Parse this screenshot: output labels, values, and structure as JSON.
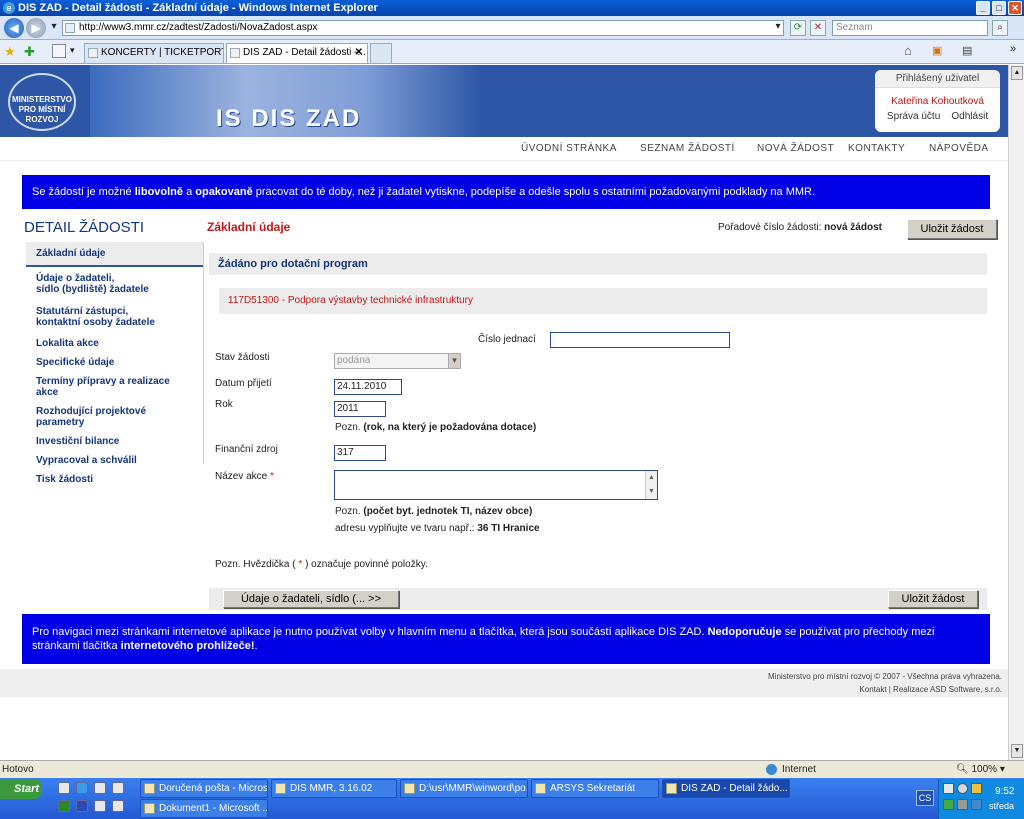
{
  "window": {
    "title": "DIS ZAD - Detail žádosti - Základní údaje - Windows Internet Explorer"
  },
  "browser": {
    "url": "http://www3.mmr.cz/zadtest/Zadosti/NovaZadost.aspx",
    "search_placeholder": "Seznam",
    "tabs": [
      "KONCERTY | TICKETPORTAL...",
      "DIS ZAD - Detail žádosti -..."
    ]
  },
  "header": {
    "logo_text": "MINISTERSTVO PRO MÍSTNÍ ROZVOJ",
    "brand": "IS DIS ZAD",
    "user_box_title": "Přihlášený uživatel",
    "user_name": "Kateřina Kohoutková",
    "account_link": "Správa účtu",
    "logout_link": "Odhlásit"
  },
  "nav": {
    "items": [
      "ÚVODNÍ STRÁNKA",
      "SEZNAM ŽÁDOSTÍ",
      "NOVÁ ŽÁDOST",
      "KONTAKTY",
      "NÁPOVĚDA"
    ]
  },
  "info_top": {
    "p1": "Se žádostí je možné ",
    "b1": "libovolně",
    "p2": " a ",
    "b2": "opakovaně",
    "p3": " pracovat do té doby, než ji žadatel vytiskne, podepíše a odešle spolu s ostatními požadovanými podklady na MMR."
  },
  "sidebar": {
    "title": "DETAIL ŽÁDOSTI",
    "items": [
      {
        "l1": "Základní údaje",
        "l2": ""
      },
      {
        "l1": "Údaje o žadateli,",
        "l2": "sídlo (bydliště) žadatele"
      },
      {
        "l1": "Statutární zástupci,",
        "l2": "kontaktní osoby žadatele"
      },
      {
        "l1": "Lokalita akce",
        "l2": ""
      },
      {
        "l1": "Specifické údaje",
        "l2": ""
      },
      {
        "l1": "Termíny přípravy a realizace akce",
        "l2": ""
      },
      {
        "l1": "Rozhodující projektové parametry",
        "l2": ""
      },
      {
        "l1": "Investiční bilance",
        "l2": ""
      },
      {
        "l1": "Vypracoval a schválil",
        "l2": ""
      },
      {
        "l1": "Tisk žádosti",
        "l2": ""
      }
    ]
  },
  "main": {
    "section_title": "Základní údaje",
    "order_label": "Pořadové číslo žádosti:",
    "order_value": "nová žádost",
    "save_button": "Uložit žádost",
    "program_heading": "Žádáno pro dotační program",
    "program_value": "117D51300 - Podpora výstavby technické infrastruktury",
    "fields": {
      "cislo_jednaci_label": "Číslo jednací",
      "cislo_jednaci_value": "",
      "stav_label": "Stav žádosti",
      "stav_value": "podána",
      "datum_label": "Datum přijetí",
      "datum_value": "24.11.2010",
      "rok_label": "Rok",
      "rok_value": "2011",
      "rok_note_prefix": "Pozn.",
      "rok_note": "(rok, na který je požadována dotace)",
      "zdroj_label": "Finanční zdroj",
      "zdroj_value": "317",
      "nazev_label": "Název akce",
      "required_mark": "*",
      "nazev_value": "",
      "nazev_note_prefix": "Pozn.",
      "nazev_note": "(počet byt. jednotek TI, název obce)",
      "nazev_note2_prefix": "adresu vyplňujte ve tvaru např.:",
      "nazev_note2": "36 TI Hranice"
    },
    "req_note_a": "Pozn. Hvězdička (",
    "req_note_b": ") označuje povinné položky.",
    "next_button": "Údaje o žadateli, sídlo (...   >>",
    "save_button_bottom": "Uložit žádost"
  },
  "info_bottom": {
    "p1": "Pro navigaci mezi stránkami internetové aplikace je nutno používat volby v hlavním menu a tlačítka, která jsou součástí aplikace DIS ZAD. ",
    "b1": "Nedoporučuje",
    "p2": " se používat pro přechody mezi stránkami tlačítka ",
    "b2": "internetového prohlížeče!",
    "p3": "."
  },
  "footer": {
    "line1": "Ministerstvo pro místní rozvoj © 2007 - Všechna práva vyhrazena.",
    "line2": "Kontakt  |  Realizace ASD Software, s.r.o."
  },
  "statusbar": {
    "status": "Hotovo",
    "zone": "Internet",
    "zoom": "100%"
  },
  "taskbar": {
    "start": "Start",
    "buttons": [
      "Doručená pošta - Micros...",
      "DIS MMR, 3.16.02",
      "D:\\usr\\MMR\\winword\\po...",
      "ARSYS Sekretariát",
      "DIS ZAD - Detail žádo..."
    ],
    "row2": [
      "Dokument1 - Microsoft ..."
    ],
    "lang": "CS",
    "time": "9:52",
    "day": "středa"
  }
}
